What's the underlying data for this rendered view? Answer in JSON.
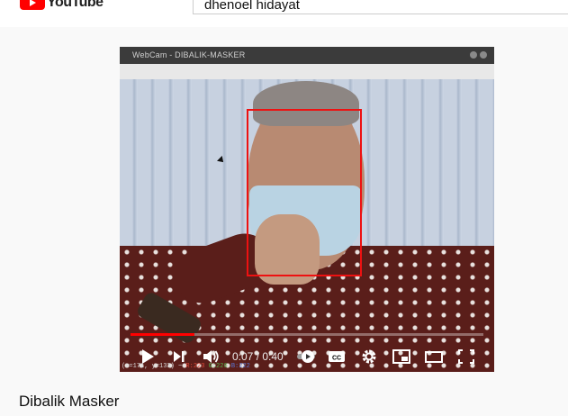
{
  "header": {
    "logo_text": "YouTube",
    "search_value": "dhenoel hidayat"
  },
  "player": {
    "window_title": "WebCam - DIBALIK-MASKER",
    "time_current": "0:07",
    "time_total": "0:40",
    "time_display": "0:07 / 0:40",
    "progress": 0.18,
    "status_coords": "(x=171, y=133) ~ ",
    "status_r": "R:223",
    "status_g": "G:226",
    "status_b": "B:222",
    "cc_label": "CC"
  },
  "video_title": "Dibalik Masker",
  "colors": {
    "accent": "#ff0000",
    "page_bg": "#f9f9f9"
  }
}
